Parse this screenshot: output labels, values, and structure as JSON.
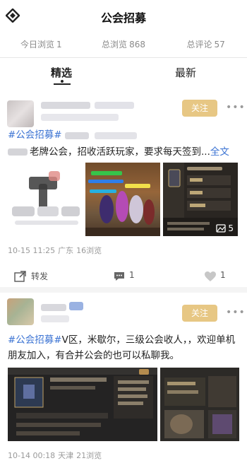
{
  "header": {
    "title": "公会招募",
    "logo_icon": "diamond-logo-icon"
  },
  "stats": [
    {
      "label": "今日浏览",
      "value": "1"
    },
    {
      "label": "总浏览",
      "value": "868"
    },
    {
      "label": "总评论",
      "value": "57"
    }
  ],
  "tabs": {
    "featured": "精选",
    "latest": "最新"
  },
  "posts": [
    {
      "follow_label": "关注",
      "tag": "#公会招募#",
      "line1_prefix": "老牌公会，招收活跃玩家，要求每天签到",
      "ellipsis": "...",
      "full_text": "全文",
      "image_count": "5",
      "time": "10-15 11:25",
      "location": "广东",
      "views": "16浏览",
      "share_label": "转发",
      "comment_count": "1",
      "like_count": "1"
    },
    {
      "follow_label": "关注",
      "tag": "#公会招募#",
      "text": "V区，米歇尔，三级公会收人，，欢迎单机朋友加入，有合并公会的也可以私聊我。",
      "time": "10-14 00:18",
      "location": "天津",
      "views": "21浏览"
    }
  ],
  "colors": {
    "accent": "#e7c784",
    "tag": "#3b73d3"
  }
}
